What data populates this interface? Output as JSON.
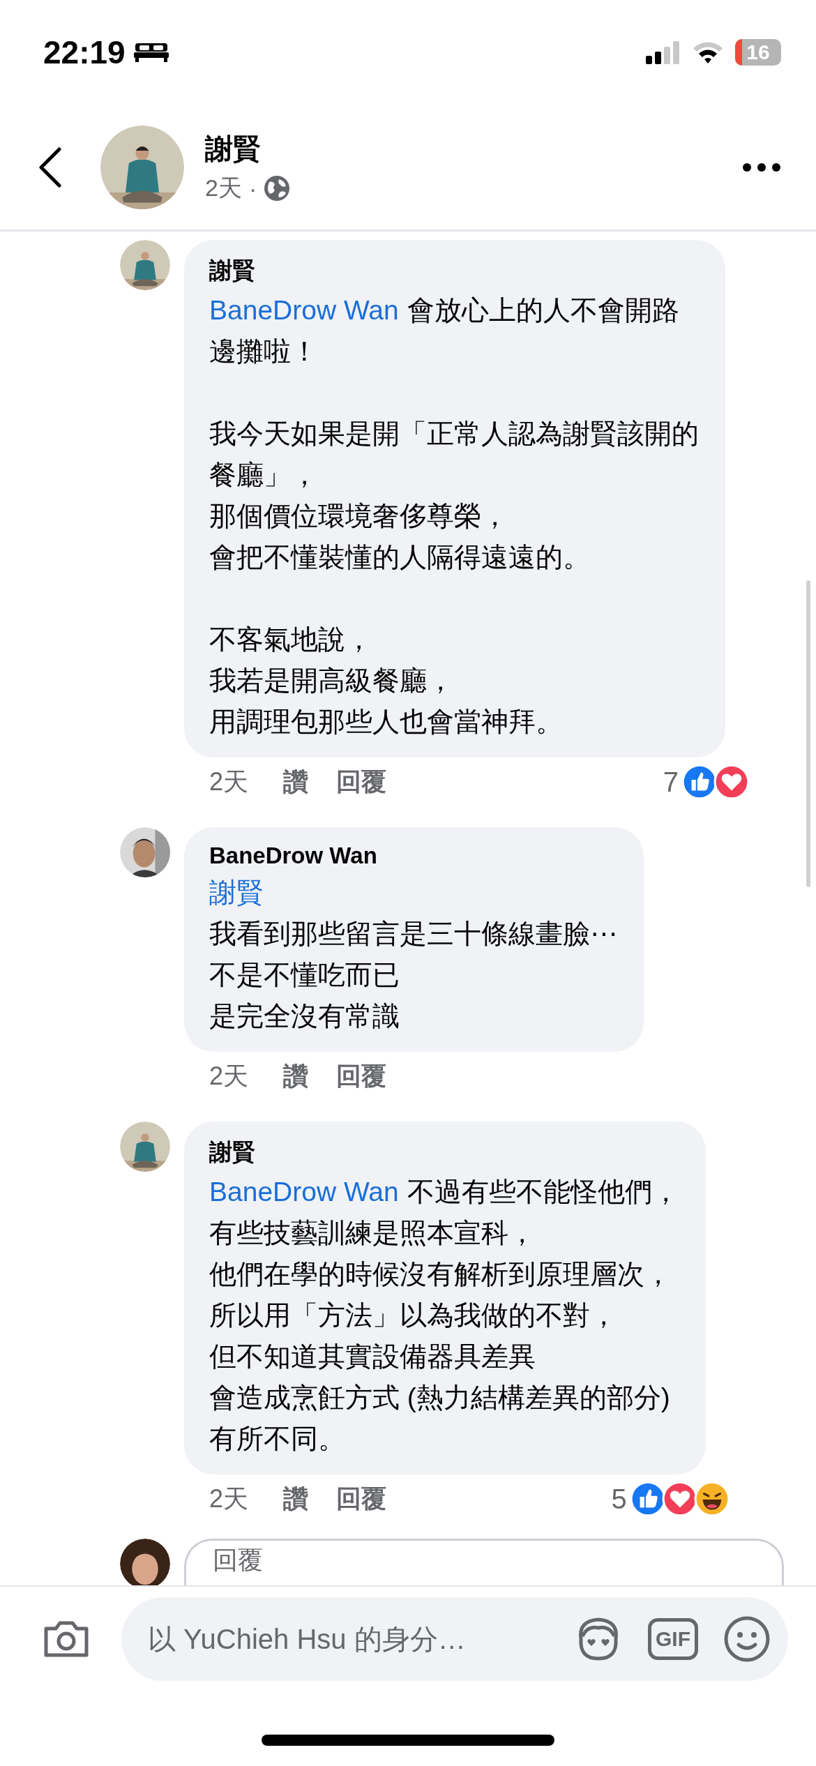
{
  "status_bar": {
    "time": "22:19",
    "battery": "16"
  },
  "post_header": {
    "author": "謝賢",
    "age": "2天",
    "separator": "·"
  },
  "comments": [
    {
      "author": "謝賢",
      "paragraphs": [
        [
          {
            "mention": "BaneDrow Wan",
            "text": "會放心上的人不會開路"
          },
          {
            "text": "邊攤啦！"
          }
        ],
        [
          {
            "text": "我今天如果是開「正常人認為謝賢該開的"
          },
          {
            "text": "餐廳」，"
          },
          {
            "text": "那個價位環境奢侈尊榮，"
          },
          {
            "text": "會把不懂裝懂的人隔得遠遠的。"
          }
        ],
        [
          {
            "text": "不客氣地說，"
          },
          {
            "text": "我若是開高級餐廳，"
          },
          {
            "text": "用調理包那些人也會當神拜。"
          }
        ]
      ],
      "age": "2天",
      "like_label": "讚",
      "reply_label": "回覆",
      "reaction_count": "7",
      "reactions": [
        {
          "kind": "like"
        },
        {
          "kind": "love"
        }
      ]
    },
    {
      "author": "BaneDrow Wan",
      "paragraphs": [
        [
          {
            "mention": "謝賢"
          },
          {
            "text": "我看到那些留言是三十條線畫臉⋯"
          },
          {
            "text": "不是不懂吃而已"
          },
          {
            "text": "是完全沒有常識"
          }
        ]
      ],
      "age": "2天",
      "like_label": "讚",
      "reply_label": "回覆"
    },
    {
      "author": "謝賢",
      "paragraphs": [
        [
          {
            "mention": "BaneDrow Wan",
            "text": "不過有些不能怪他們，"
          },
          {
            "text": "有些技藝訓練是照本宣科，"
          },
          {
            "text": "他們在學的時候沒有解析到原理層次，"
          },
          {
            "text": "所以用「方法」以為我做的不對，"
          },
          {
            "text": "但不知道其實設備器具差異"
          },
          {
            "text": "會造成烹飪方式 (熱力結構差異的部分)"
          },
          {
            "text": "有所不同。"
          }
        ]
      ],
      "age": "2天",
      "like_label": "讚",
      "reply_label": "回覆",
      "reaction_count": "5",
      "reactions": [
        {
          "kind": "like"
        },
        {
          "kind": "love"
        },
        {
          "kind": "haha"
        }
      ]
    }
  ],
  "reply_field": {
    "placeholder": "回覆"
  },
  "composer": {
    "placeholder": "以 YuChieh Hsu 的身分…",
    "gif_label": "GIF"
  }
}
